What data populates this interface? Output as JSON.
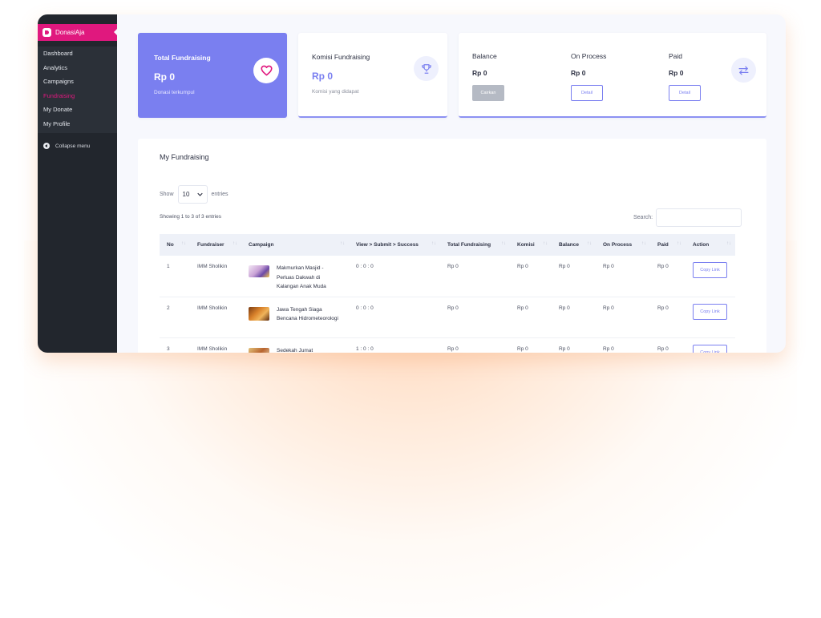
{
  "sidebar": {
    "brand": "DonasiAja",
    "items": [
      {
        "label": "Dashboard"
      },
      {
        "label": "Analytics"
      },
      {
        "label": "Campaigns"
      },
      {
        "label": "Fundraising",
        "active": true
      },
      {
        "label": "My Donate"
      },
      {
        "label": "My Profile"
      }
    ],
    "collapse_label": "Collapse menu"
  },
  "cards": {
    "total": {
      "label": "Total Fundraising",
      "amount": "Rp 0",
      "sub": "Donasi terkumpul",
      "icon": "heart-icon"
    },
    "komisi": {
      "label": "Komisi Fundraising",
      "amount": "Rp 0",
      "sub": "Komisi yang didapat",
      "icon": "trophy-icon"
    },
    "balance": {
      "icon": "swap-icon",
      "columns": [
        {
          "label": "Balance",
          "amount": "Rp 0",
          "button": "Cairkan"
        },
        {
          "label": "On Process",
          "amount": "Rp 0",
          "button": "Detail"
        },
        {
          "label": "Paid",
          "amount": "Rp 0",
          "button": "Detail"
        }
      ]
    }
  },
  "table_panel": {
    "title": "My Fundraising",
    "show_label": "Show",
    "entries_value": "10",
    "entries_label": "entries",
    "showing_text": "Showing 1 to 3 of 3 entries",
    "search_label": "Search:",
    "columns": [
      "No",
      "Fundraiser",
      "Campaign",
      "View > Submit > Success",
      "Total Fundraising",
      "Komisi",
      "Balance",
      "On Process",
      "Paid",
      "Action"
    ],
    "rows": [
      {
        "no": "1",
        "fundraiser": "IMM Sholikin",
        "campaign": "Makmurkan Masjid - Perluas Dakwah di Kalangan Anak Muda",
        "vss": "0 : 0 : 0",
        "total": "Rp 0",
        "komisi": "Rp 0",
        "balance": "Rp 0",
        "on_process": "Rp 0",
        "paid": "Rp 0",
        "action": "Copy Link"
      },
      {
        "no": "2",
        "fundraiser": "IMM Sholikin",
        "campaign": "Jawa Tengah Siaga Bencana Hidrometeorologi",
        "vss": "0 : 0 : 0",
        "total": "Rp 0",
        "komisi": "Rp 0",
        "balance": "Rp 0",
        "on_process": "Rp 0",
        "paid": "Rp 0",
        "action": "Copy Link"
      },
      {
        "no": "3",
        "fundraiser": "IMM Sholikin",
        "campaign": "Sedekah Jumat",
        "vss": "1 : 0 : 0",
        "total": "Rp 0",
        "komisi": "Rp 0",
        "balance": "Rp 0",
        "on_process": "Rp 0",
        "paid": "Rp 0",
        "action": "Copy Link"
      }
    ]
  },
  "colors": {
    "accent": "#7a7ff0",
    "brand": "#e0187e",
    "sidebar": "#22262d"
  }
}
